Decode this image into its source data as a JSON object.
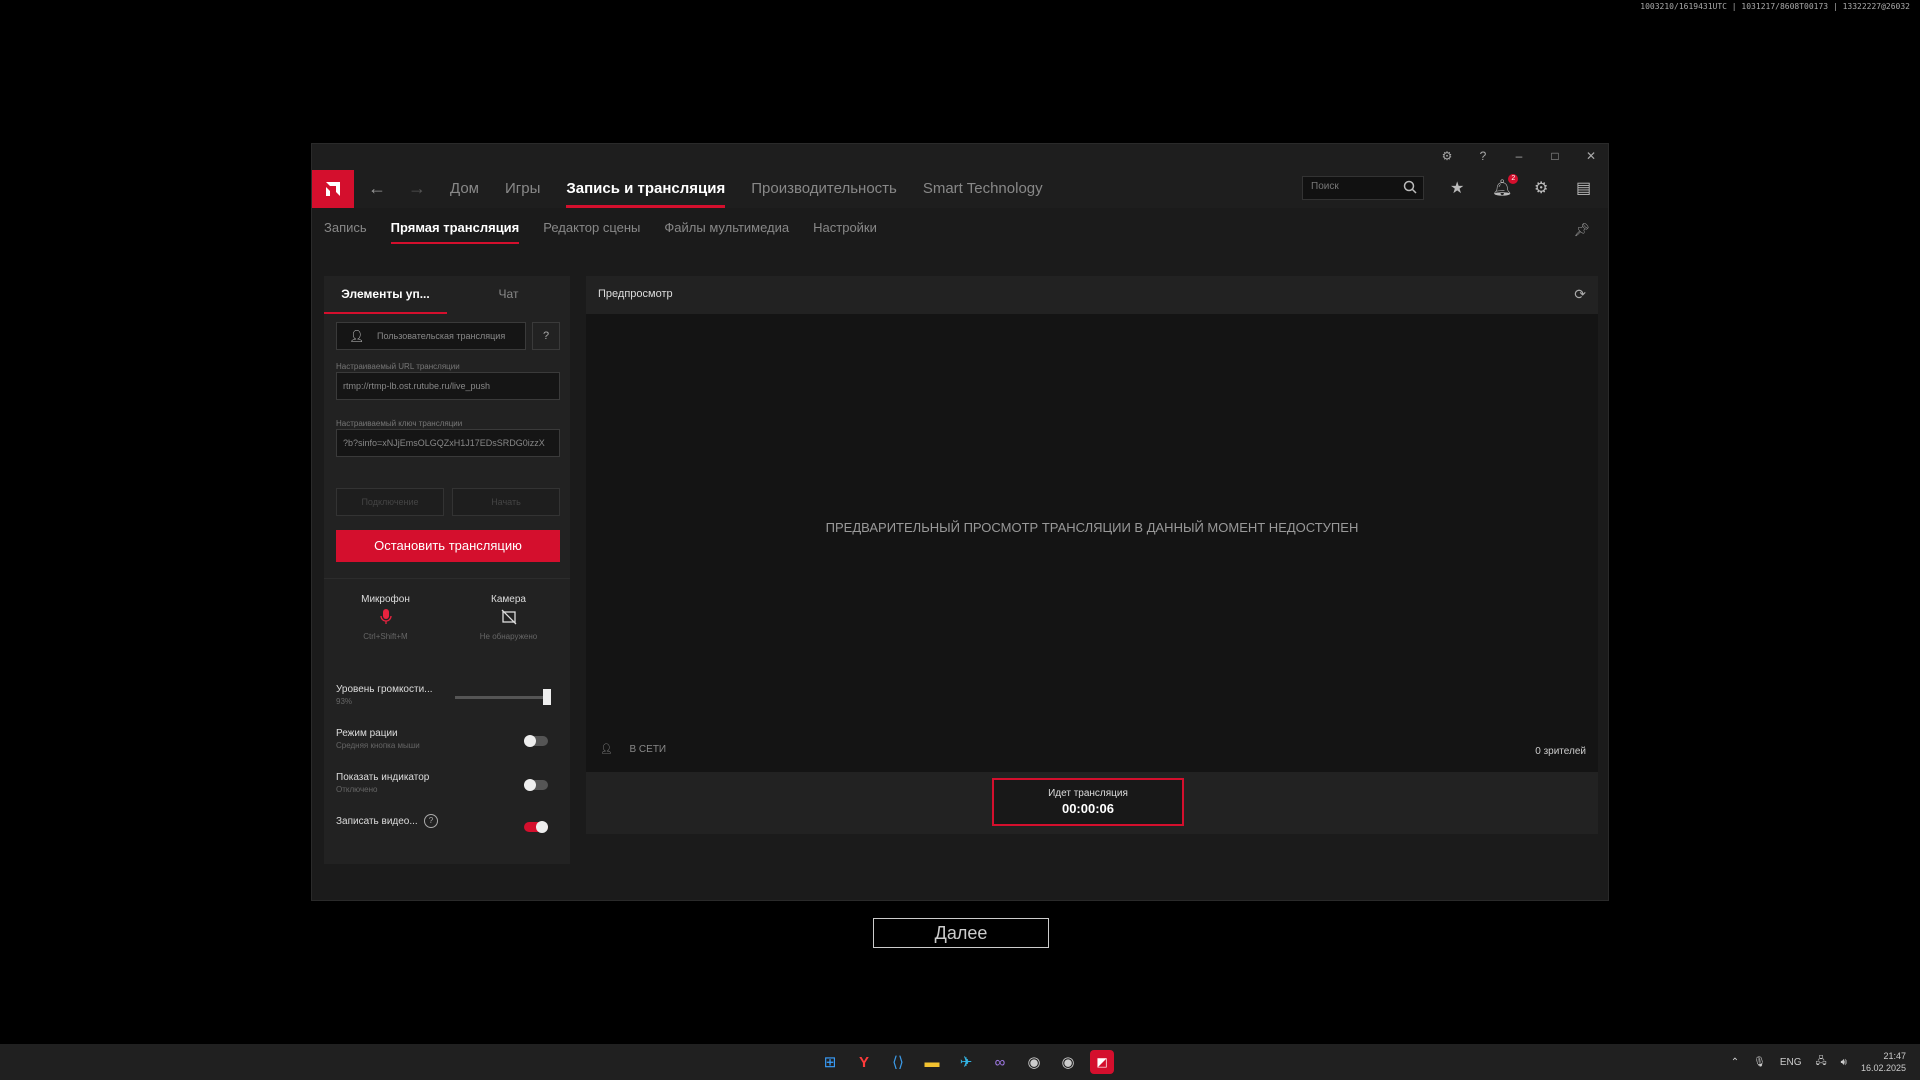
{
  "overlay_text": "1003210/1619431UTC | 1031217/8608T00173 | 13322227@26032",
  "window": {
    "controls": [
      "⚙",
      "?",
      "–",
      "□",
      "✕"
    ]
  },
  "nav": {
    "main_tabs": [
      "Дом",
      "Игры",
      "Запись и трансляция",
      "Производительность",
      "Smart Technology"
    ],
    "active_main_tab": 2,
    "search_placeholder": "Поиск",
    "notification_count": "2"
  },
  "subtabs": [
    "Запись",
    "Прямая трансляция",
    "Редактор сцены",
    "Файлы мультимедиа",
    "Настройки"
  ],
  "left_panel": {
    "tabs": [
      "Элементы уп...",
      "Чат"
    ],
    "stream_service": "Пользовательская трансляция",
    "url_label": "Настраиваемый URL трансляции",
    "url_value": "rtmp://rtmp-lb.ost.rutube.ru/live_push",
    "key_label": "Настраиваемый ключ трансляции",
    "key_value": "?b?sinfo=xNJjEmsOLGQZxH1J17EDsSRDG0izzX",
    "ghost_btn_1": "Подключение",
    "ghost_btn_2": "Начать",
    "stop_button": "Остановить трансляцию",
    "mic_title": "Микрофон",
    "mic_sub": "Ctrl+Shift+M",
    "cam_title": "Камера",
    "cam_sub": "Не обнаружено",
    "volume_label": "Уровень громкости...",
    "volume_sub": "93%",
    "volume_level": 0.93,
    "ptt_label": "Режим рации",
    "ptt_sub": "Средняя кнопка мыши",
    "indicator_label": "Показать индикатор",
    "indicator_sub": "Отключено",
    "record_label": "Записать видео..."
  },
  "preview": {
    "title": "Предпросмотр",
    "message": "ПРЕДВАРИТЕЛЬНЫЙ ПРОСМОТР ТРАНСЛЯЦИИ В ДАННЫЙ МОМЕНТ НЕДОСТУПЕН",
    "online_status": "В СЕТИ",
    "viewers": "0 зрителей",
    "live_title": "Идет трансляция",
    "live_timer": "00:00:06"
  },
  "next_button": "Далее",
  "taskbar": {
    "language": "ENG",
    "time": "21:47",
    "date": "16.02.2025"
  },
  "colors": {
    "accent": "#d40f2d",
    "window_bg": "#1b1b1b"
  }
}
